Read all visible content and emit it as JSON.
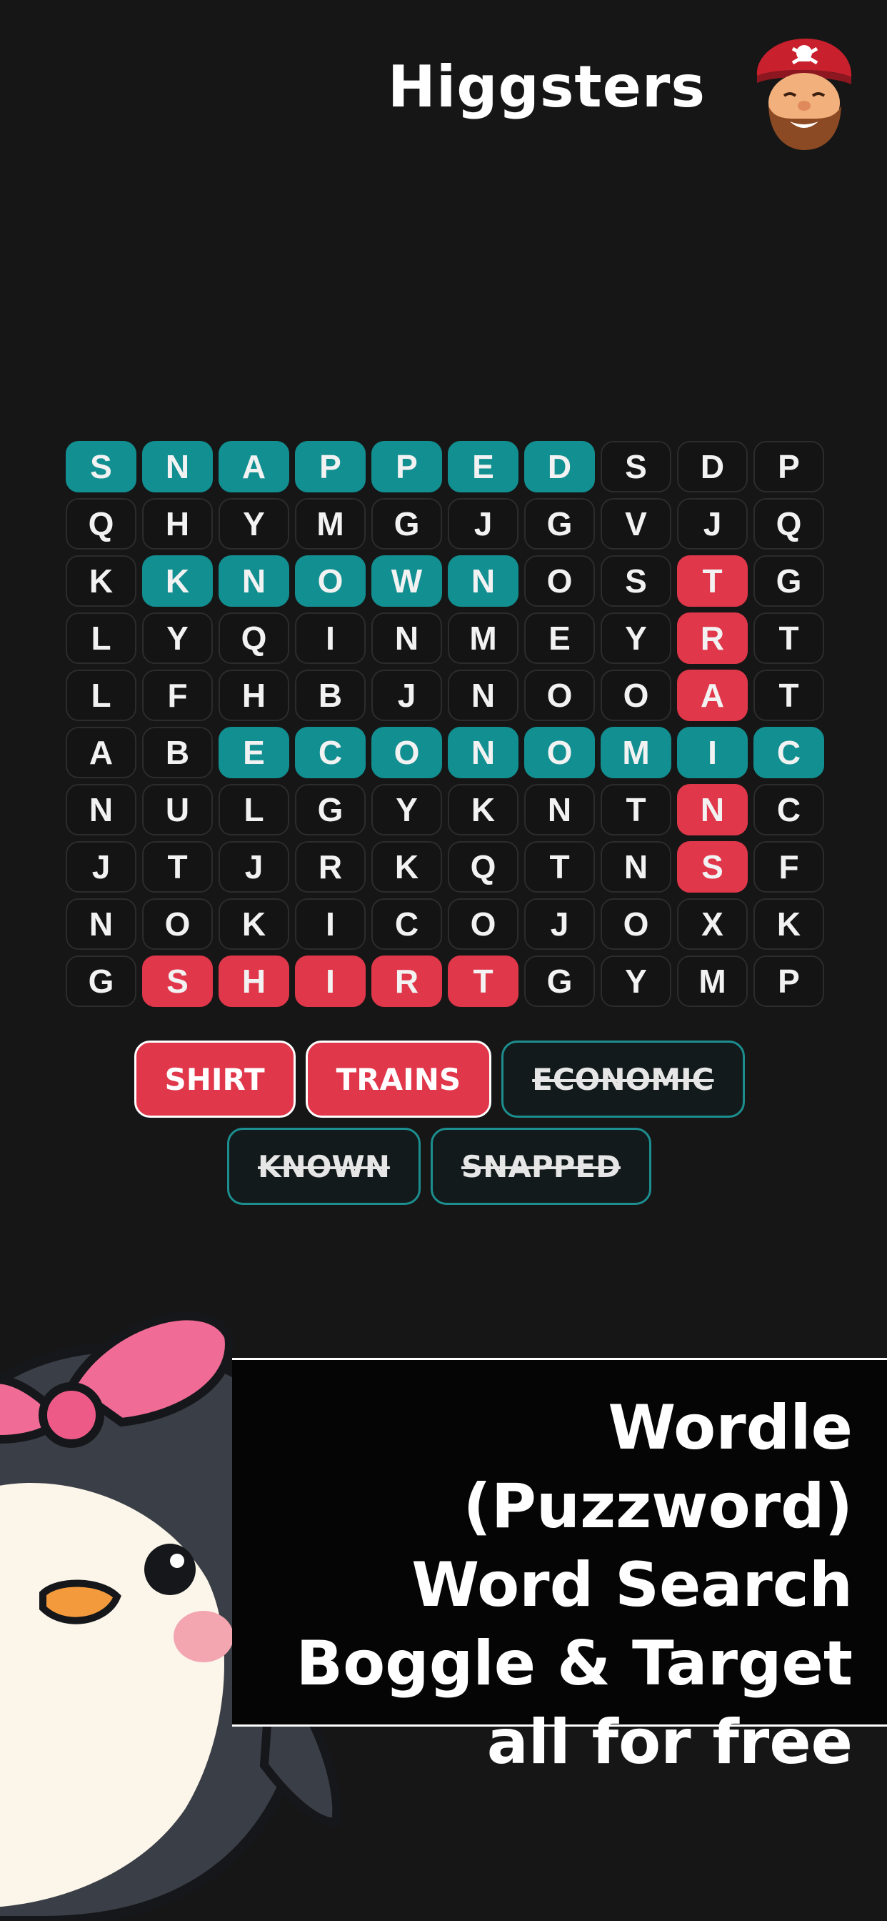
{
  "header": {
    "title": "Higgsters",
    "mascot_icon": "pirate-mascot-icon"
  },
  "grid": {
    "rows": [
      [
        "S",
        "N",
        "A",
        "P",
        "P",
        "E",
        "D",
        "S",
        "D",
        "P"
      ],
      [
        "Q",
        "H",
        "Y",
        "M",
        "G",
        "J",
        "G",
        "V",
        "J",
        "Q"
      ],
      [
        "K",
        "K",
        "N",
        "O",
        "W",
        "N",
        "O",
        "S",
        "T",
        "G"
      ],
      [
        "L",
        "Y",
        "Q",
        "I",
        "N",
        "M",
        "E",
        "Y",
        "R",
        "T"
      ],
      [
        "L",
        "F",
        "H",
        "B",
        "J",
        "N",
        "O",
        "O",
        "A",
        "T"
      ],
      [
        "A",
        "B",
        "E",
        "C",
        "O",
        "N",
        "O",
        "M",
        "I",
        "C"
      ],
      [
        "N",
        "U",
        "L",
        "G",
        "Y",
        "K",
        "N",
        "T",
        "N",
        "C"
      ],
      [
        "J",
        "T",
        "J",
        "R",
        "K",
        "Q",
        "T",
        "N",
        "S",
        "F"
      ],
      [
        "N",
        "O",
        "K",
        "I",
        "C",
        "O",
        "J",
        "O",
        "X",
        "K"
      ],
      [
        "G",
        "S",
        "H",
        "I",
        "R",
        "T",
        "G",
        "Y",
        "M",
        "P"
      ]
    ],
    "highlight": [
      [
        "teal",
        "teal",
        "teal",
        "teal",
        "teal",
        "teal",
        "teal",
        "",
        "",
        ""
      ],
      [
        "",
        "",
        "",
        "",
        "",
        "",
        "",
        "",
        "",
        ""
      ],
      [
        "",
        "teal",
        "teal",
        "teal",
        "teal",
        "teal",
        "",
        "",
        "red",
        ""
      ],
      [
        "",
        "",
        "",
        "",
        "",
        "",
        "",
        "",
        "red",
        ""
      ],
      [
        "",
        "",
        "",
        "",
        "",
        "",
        "",
        "",
        "red",
        ""
      ],
      [
        "",
        "",
        "teal",
        "teal",
        "teal",
        "teal",
        "teal",
        "teal",
        "teal",
        "teal"
      ],
      [
        "",
        "",
        "",
        "",
        "",
        "",
        "",
        "",
        "red",
        ""
      ],
      [
        "",
        "",
        "",
        "",
        "",
        "",
        "",
        "",
        "red",
        ""
      ],
      [
        "",
        "",
        "",
        "",
        "",
        "",
        "",
        "",
        "",
        ""
      ],
      [
        "",
        "red",
        "red",
        "red",
        "red",
        "red",
        "",
        "",
        "",
        ""
      ]
    ],
    "colors": {
      "teal": "#128f91",
      "red": "#e0374a"
    }
  },
  "words": [
    {
      "label": "SHIRT",
      "state": "active"
    },
    {
      "label": "TRAINS",
      "state": "active"
    },
    {
      "label": "ECONOMIC",
      "state": "found"
    },
    {
      "label": "KNOWN",
      "state": "found"
    },
    {
      "label": "SNAPPED",
      "state": "found"
    }
  ],
  "banner": {
    "lines": [
      "Wordle (Puzzword)",
      "Word Search",
      "Boggle & Target",
      "all for free"
    ]
  },
  "illustration": {
    "icon": "penguin-with-bow-icon"
  }
}
